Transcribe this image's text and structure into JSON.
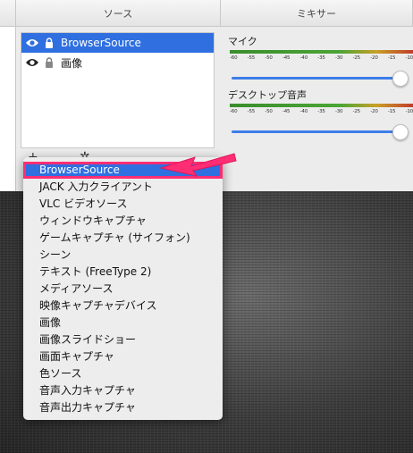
{
  "panels": {
    "sources_title": "ソース",
    "mixer_title": "ミキサー"
  },
  "sources": [
    {
      "label": "BrowserSource",
      "selected": true,
      "visible_icon": "eye-icon",
      "lock_icon": "lock-icon"
    },
    {
      "label": "画像",
      "selected": false,
      "visible_icon": "eye-icon",
      "lock_icon": "lock-icon"
    }
  ],
  "toolbar": {
    "add_icon": "plus-icon",
    "settings_icon": "gear-icon"
  },
  "mixer": [
    {
      "label": "マイク",
      "scale": [
        "-60",
        "-55",
        "-50",
        "-45",
        "-40",
        "-35",
        "-30",
        "-25",
        "-20",
        "-15",
        "-10"
      ],
      "volume": 0.97
    },
    {
      "label": "デスクトップ音声",
      "scale": [
        "-60",
        "-55",
        "-50",
        "-45",
        "-40",
        "-35",
        "-30",
        "-25",
        "-20",
        "-15",
        "-10"
      ],
      "volume": 0.97
    }
  ],
  "menu": {
    "items": [
      "BrowserSource",
      "JACK 入力クライアント",
      "VLC ビデオソース",
      "ウィンドウキャプチャ",
      "ゲームキャプチャ (サイフォン)",
      "シーン",
      "テキスト (FreeType 2)",
      "メディアソース",
      "映像キャプチャデバイス",
      "画像",
      "画像スライドショー",
      "画面キャプチャ",
      "色ソース",
      "音声入力キャプチャ",
      "音声出力キャプチャ"
    ],
    "highlighted_index": 0
  },
  "colors": {
    "selection": "#2f6fe0",
    "annotation": "#ff2d74"
  }
}
